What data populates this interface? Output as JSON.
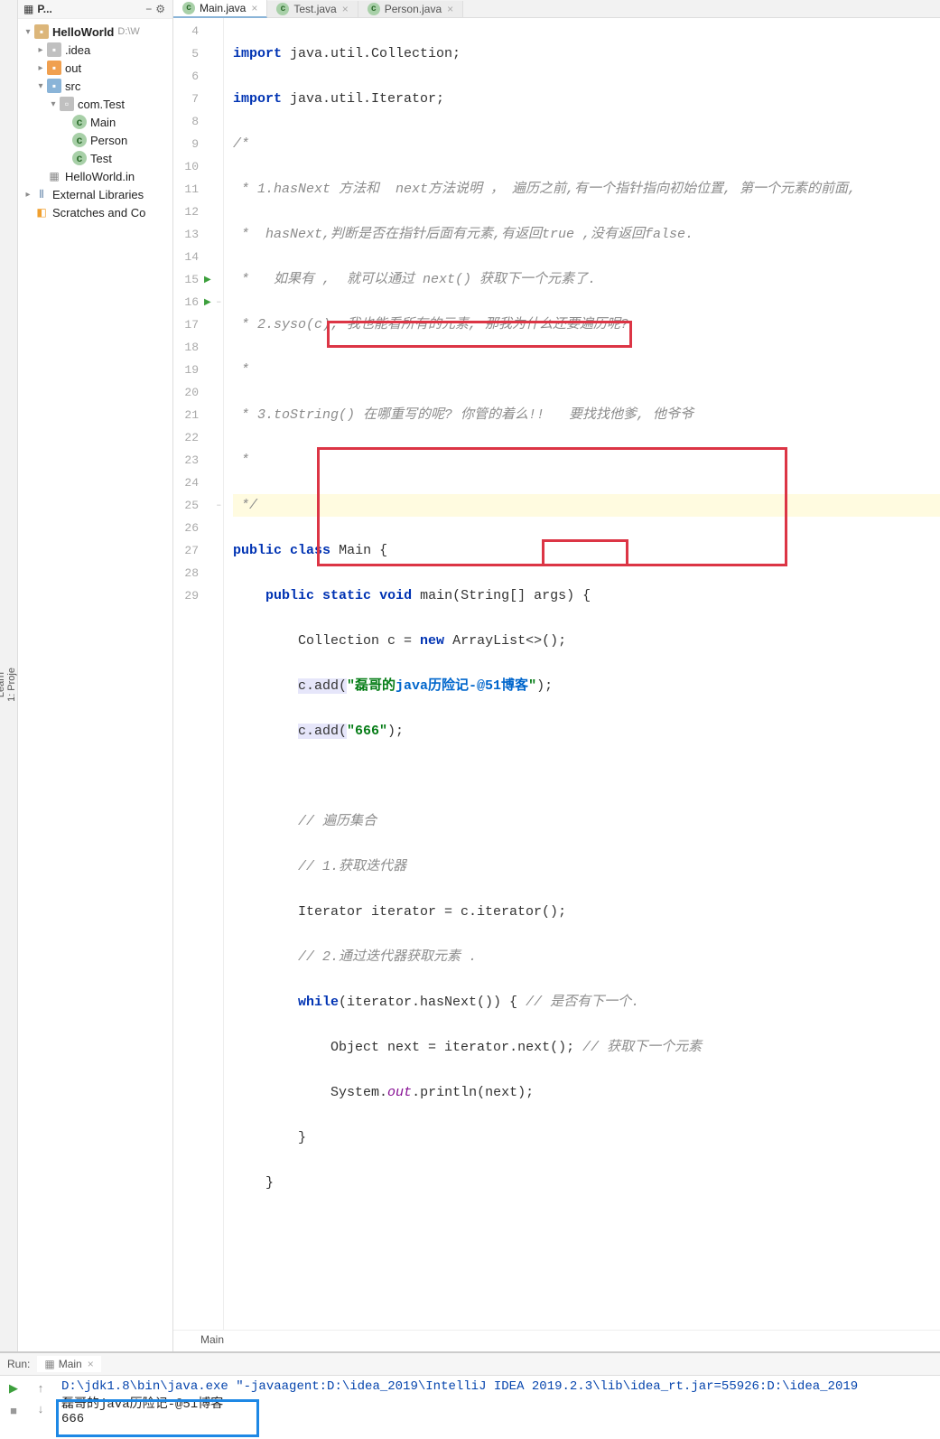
{
  "project_header": {
    "title": "P..."
  },
  "tree": {
    "root": {
      "name": "HelloWorld",
      "path": "D:\\W"
    },
    "idea": ".idea",
    "out": "out",
    "src": "src",
    "pkg": "com.Test",
    "main": "Main",
    "person": "Person",
    "test": "Test",
    "iml": "HelloWorld.in",
    "ext": "External Libraries",
    "scratch": "Scratches and Co"
  },
  "tabs": {
    "t0": "Main.java",
    "t1": "Test.java",
    "t2": "Person.java"
  },
  "code": {
    "l4": "import java.util.Collection;",
    "l5": "import java.util.Iterator;",
    "l6": "/*",
    "l7": " * 1.hasNext 方法和  next方法说明 ， 遍历之前,有一个指针指向初始位置, 第一个元素的前面,",
    "l8": " *  hasNext,判断是否在指针后面有元素,有返回true ,没有返回false.",
    "l9": " *   如果有 ,  就可以通过 next() 获取下一个元素了.",
    "l10": " * 2.syso(c); 我也能看所有的元素, 那我为什么还要遍历呢?",
    "l11": " *",
    "l12": " * 3.toString() 在哪重写的呢? 你管的着么!!   要找找他爹, 他爷爷",
    "l13": " *",
    "l14": " */",
    "l15_public": "public",
    "l15_class": "class",
    "l15_Main": "Main {",
    "l16_public": "public",
    "l16_static": "static",
    "l16_void": "void",
    "l16_rest": "main(String[] args) {",
    "l17_a": "Collection c = ",
    "l17_new": "new",
    "l17_b": " ArrayList<>();",
    "l18_a": "c.add(",
    "l18_s1": "\"磊哥的",
    "l18_s2": "java历险记-@51博客",
    "l18_s3": "\"",
    "l18_b": ");",
    "l19_a": "c.add(",
    "l19_s": "\"666\"",
    "l19_b": ");",
    "l21": "// 遍历集合",
    "l22": "// 1.获取迭代器",
    "l23": "Iterator iterator = c.iterator();",
    "l24": "// 2.通过迭代器获取元素 .",
    "l25_while": "while",
    "l25_a": "(iterator.hasNext()) { ",
    "l25_c": "// 是否有下一个.",
    "l26_a": "Object next = iterator.next(); ",
    "l26_c": "// 获取下一个元素",
    "l27_a": "System.",
    "l27_out": "out",
    "l27_b": ".println(next);",
    "l28": "}",
    "l29": "}"
  },
  "breadcrumb": "Main",
  "run": {
    "label": "Run:",
    "tab": "Main",
    "cmd": "D:\\jdk1.8\\bin\\java.exe \"-javaagent:D:\\idea_2019\\IntelliJ IDEA 2019.2.3\\lib\\idea_rt.jar=55926:D:\\idea_2019",
    "out1": "磊哥的java历险记-@51博客",
    "out2": "666"
  }
}
